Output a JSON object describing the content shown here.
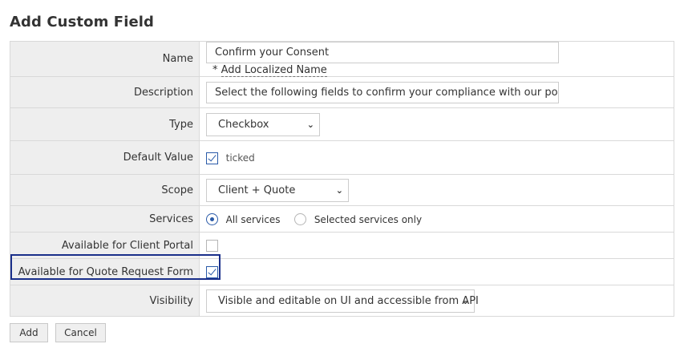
{
  "page": {
    "title": "Add Custom Field"
  },
  "form": {
    "name": {
      "label": "Name",
      "value": "Confirm your Consent",
      "localized_prefix": "*",
      "localized_link": "Add Localized Name"
    },
    "description": {
      "label": "Description",
      "value": "Select the following fields to confirm your compliance with our policie"
    },
    "type": {
      "label": "Type",
      "selected": "Checkbox"
    },
    "default_value": {
      "label": "Default Value",
      "checked": true,
      "text": "ticked"
    },
    "scope": {
      "label": "Scope",
      "selected": "Client + Quote"
    },
    "services": {
      "label": "Services",
      "options": [
        "All services",
        "Selected services only"
      ],
      "selected": "All services"
    },
    "client_portal": {
      "label": "Available for Client Portal",
      "checked": false
    },
    "quote_form": {
      "label": "Available for Quote Request Form",
      "checked": true
    },
    "visibility": {
      "label": "Visibility",
      "selected": "Visible and editable on UI and accessible from API"
    }
  },
  "actions": {
    "add": "Add",
    "cancel": "Cancel"
  },
  "colors": {
    "label_bg": "#eeeeee",
    "border": "#d9d9d9",
    "highlight": "#1a2f8a",
    "accent": "#2a5aa8"
  }
}
